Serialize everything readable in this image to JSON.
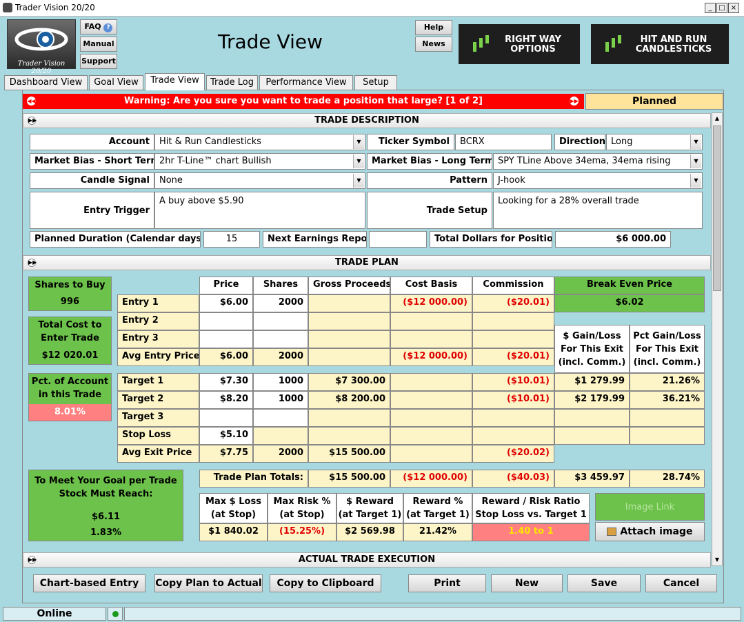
{
  "window": {
    "title": "Trader Vision 20/20",
    "minimize": "_",
    "maximize": "□",
    "close": "×"
  },
  "header": {
    "logo_caption": "Trader Vision 20/20",
    "faq": "FAQ",
    "faq_help_icon": "?",
    "manual": "Manual",
    "support": "Support",
    "page_title": "Trade View",
    "help": "Help",
    "news": "News",
    "banner1": [
      "RIGHT WAY",
      "OPTIONS"
    ],
    "banner2": [
      "HIT AND RUN",
      "CANDLESTICKS"
    ]
  },
  "tabs": [
    {
      "label": "Dashboard View"
    },
    {
      "label": "Goal View"
    },
    {
      "label": "Trade View",
      "active": true
    },
    {
      "label": "Trade Log"
    },
    {
      "label": "Performance View"
    },
    {
      "label": "Setup"
    }
  ],
  "warning": {
    "text": "Warning: Are you sure you want to trade a position that large? [1 of 2]",
    "status": "Planned"
  },
  "trade_description": {
    "title": "TRADE DESCRIPTION",
    "account_label": "Account",
    "account": "Hit & Run Candlesticks",
    "ticker_label": "Ticker Symbol",
    "ticker": "BCRX",
    "direction_label": "Direction",
    "direction": "Long",
    "bias_short_label": "Market Bias - Short Term",
    "bias_short": "2hr T-Line™ chart Bullish",
    "bias_long_label": "Market Bias - Long Term",
    "bias_long": "SPY TLine Above 34ema, 34ema rising",
    "candle_label": "Candle Signal",
    "candle": "None",
    "pattern_label": "Pattern",
    "pattern": "J-hook",
    "entry_trigger_label": "Entry Trigger",
    "entry_trigger": "A buy above $5.90",
    "trade_setup_label": "Trade Setup",
    "trade_setup": "Looking for a 28% overall trade",
    "duration_label": "Planned Duration (Calendar days)",
    "duration": "15",
    "earnings_label": "Next Earnings Report",
    "earnings": "",
    "total_dollars_label": "Total Dollars for Position",
    "total_dollars": "$6 000.00"
  },
  "trade_plan": {
    "title": "TRADE PLAN",
    "shares_to_buy_label": "Shares to Buy",
    "shares_to_buy": "996",
    "total_cost_label": [
      "Total Cost to",
      "Enter Trade"
    ],
    "total_cost": "$12 020.01",
    "pct_account_label": [
      "Pct. of Account",
      "in this Trade"
    ],
    "pct_account": "8.01%",
    "goal_label": [
      "To Meet Your Goal per Trade",
      "Stock Must Reach:"
    ],
    "goal_price": "$6.11",
    "goal_pct": "1.83%",
    "columns": [
      "Price",
      "Shares",
      "Gross Proceeds",
      "Cost Basis",
      "Commission"
    ],
    "break_even_label": "Break Even Price",
    "break_even": "$6.02",
    "gain_hdr": [
      "$ Gain/Loss",
      "For This Exit",
      "(incl. Comm.)"
    ],
    "pct_hdr": [
      "Pct Gain/Loss",
      "For This Exit",
      "(incl. Comm.)"
    ],
    "rows": {
      "entry1": {
        "label": "Entry 1",
        "price": "$6.00",
        "shares": "2000",
        "cost": "($12 000.00)",
        "comm": "($20.01)"
      },
      "entry2": {
        "label": "Entry 2"
      },
      "entry3": {
        "label": "Entry 3"
      },
      "avg_entry": {
        "label": "Avg Entry Price",
        "price": "$6.00",
        "shares": "2000",
        "cost": "($12 000.00)",
        "comm": "($20.01)"
      },
      "target1": {
        "label": "Target 1",
        "price": "$7.30",
        "shares": "1000",
        "gross": "$7 300.00",
        "comm": "($10.01)",
        "gain": "$1 279.99",
        "pct": "21.26%"
      },
      "target2": {
        "label": "Target 2",
        "price": "$8.20",
        "shares": "1000",
        "gross": "$8 200.00",
        "comm": "($10.01)",
        "gain": "$2 179.99",
        "pct": "36.21%"
      },
      "target3": {
        "label": "Target 3"
      },
      "stop": {
        "label": "Stop Loss",
        "price": "$5.10"
      },
      "avg_exit": {
        "label": "Avg Exit Price",
        "price": "$7.75",
        "shares": "2000",
        "gross": "$15 500.00",
        "comm": "($20.02)"
      }
    },
    "totals": {
      "label": "Trade Plan Totals:",
      "gross": "$15 500.00",
      "cost": "($12 000.00)",
      "comm": "($40.03)",
      "gain": "$3 459.97",
      "pct": "28.74%"
    },
    "risk": {
      "max_loss_hdr": [
        "Max $ Loss",
        "(at Stop)"
      ],
      "max_loss": "$1 840.02",
      "max_risk_hdr": [
        "Max Risk %",
        "(at Stop)"
      ],
      "max_risk": "(15.25%)",
      "reward_hdr": [
        "$ Reward",
        "(at Target 1)"
      ],
      "reward": "$2 569.98",
      "reward_pct_hdr": [
        "Reward %",
        "(at Target 1)"
      ],
      "reward_pct": "21.42%",
      "ratio_hdr": [
        "Reward / Risk Ratio",
        "Stop Loss vs. Target 1"
      ],
      "ratio": "1.40 to 1"
    },
    "image_link": "Image Link",
    "attach_image": "Attach image"
  },
  "actual_execution": {
    "title": "ACTUAL TRADE EXECUTION"
  },
  "buttons": {
    "chart_entry": "Chart-based Entry",
    "copy_plan": "Copy Plan to Actual",
    "copy_clip": "Copy to Clipboard",
    "print": "Print",
    "new": "New",
    "save": "Save",
    "cancel": "Cancel"
  },
  "status": {
    "online": "Online"
  },
  "colors": {
    "background": "#a8d8e0",
    "warning_red": "#ff0000",
    "green": "#6cc24a",
    "yellow_cell": "#fdf5c8",
    "pink_alert": "#ff8080",
    "status_planned": "#fde49a"
  }
}
